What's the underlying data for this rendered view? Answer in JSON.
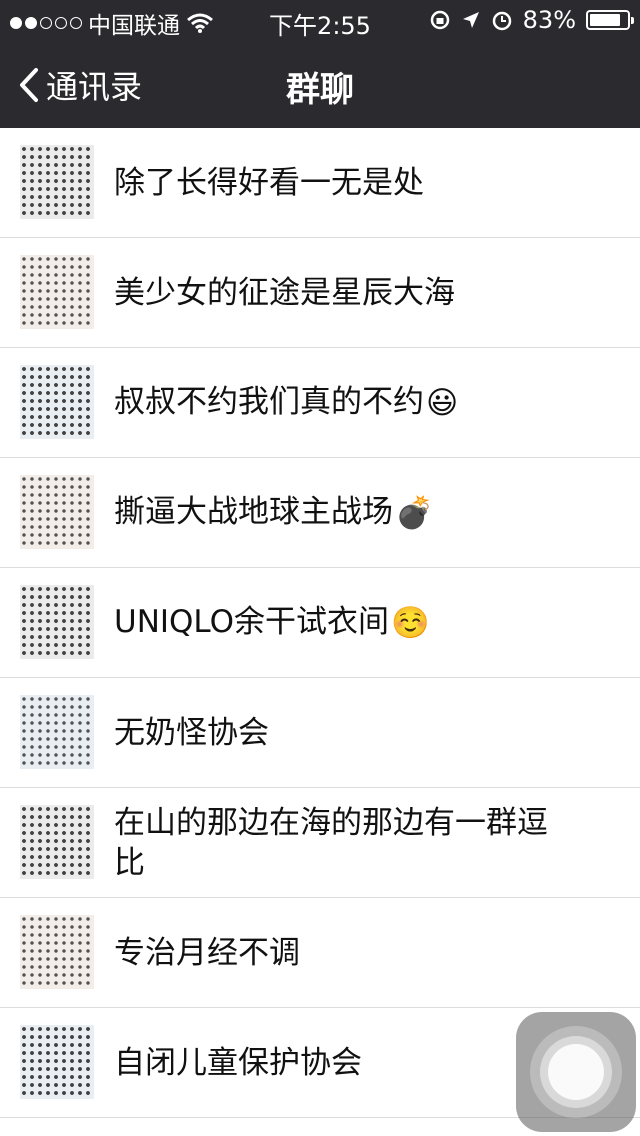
{
  "status_bar": {
    "carrier": "中国联通",
    "time": "下午2:55",
    "battery": "83%",
    "battery_level": 0.83
  },
  "nav": {
    "back_label": "通讯录",
    "title": "群聊"
  },
  "groups": [
    {
      "name": "除了长得好看一无是处",
      "emoji": ""
    },
    {
      "name": "美少女的征途是星辰大海",
      "emoji": ""
    },
    {
      "name": "叔叔不约我们真的不约",
      "emoji": "😃"
    },
    {
      "name": "撕逼大战地球主战场",
      "emoji": "💣"
    },
    {
      "name": "UNIQLO余干试衣间",
      "emoji": "☺️"
    },
    {
      "name": "无奶怪协会",
      "emoji": ""
    },
    {
      "name": "在山的那边在海的那边有一群逗比",
      "emoji": ""
    },
    {
      "name": "专治月经不调",
      "emoji": ""
    },
    {
      "name": "自闭儿童保护协会",
      "emoji": ""
    }
  ]
}
